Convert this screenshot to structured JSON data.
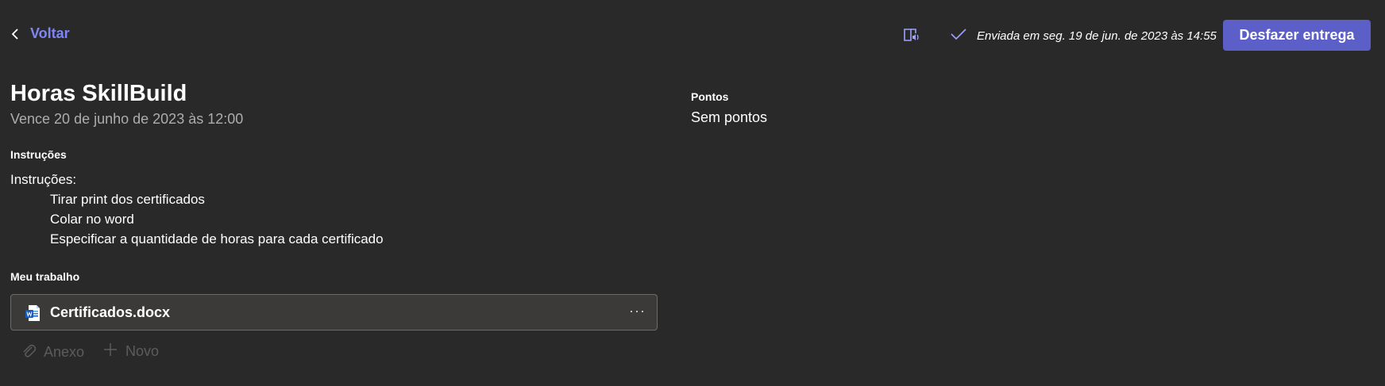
{
  "header": {
    "back_label": "Voltar",
    "submitted_text": "Enviada em seg. 19 de jun. de 2023 às 14:55",
    "undo_label": "Desfazer entrega"
  },
  "assignment": {
    "title": "Horas SkillBuild",
    "due": "Vence 20 de junho de 2023 às 12:00",
    "instructions_heading": "Instruções",
    "instructions_intro": "Instruções:",
    "instructions_items": [
      "Tirar print dos certificados",
      "Colar no word",
      "Especificar a quantidade de horas para cada certificado"
    ],
    "my_work_heading": "Meu trabalho",
    "file_name": "Certificados.docx",
    "attach_label": "Anexo",
    "new_label": "Novo"
  },
  "points": {
    "heading": "Pontos",
    "value": "Sem pontos"
  },
  "colors": {
    "background": "#292929",
    "accent": "#5b5fc7",
    "link": "#7f85f5",
    "card": "#3b3a39"
  },
  "icons": [
    "chevron-left-icon",
    "immersive-reader-icon",
    "checkmark-icon",
    "word-document-icon",
    "more-options-icon",
    "paperclip-icon",
    "plus-icon"
  ]
}
